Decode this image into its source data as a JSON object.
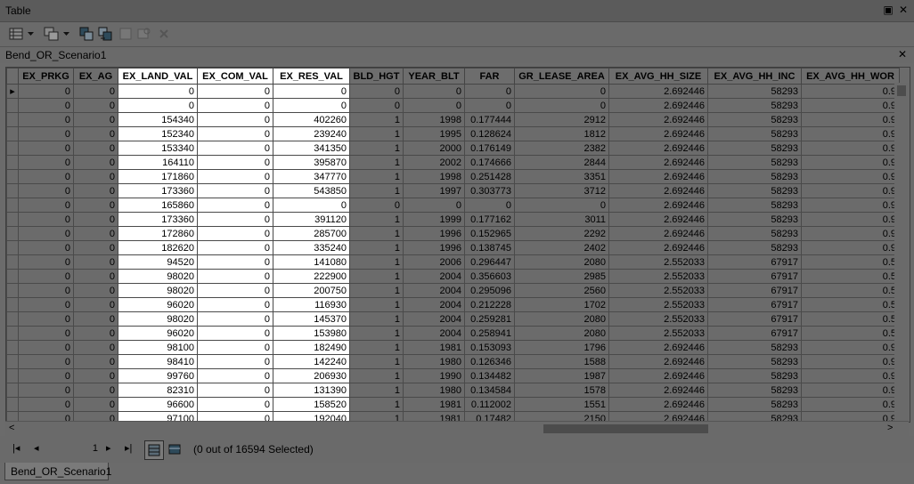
{
  "window": {
    "title": "Table",
    "restore_glyph": "▣",
    "close_glyph": "✕"
  },
  "toolbar": {
    "icons": [
      "table-options-icon",
      "dropdown-arrow-icon",
      "related-tables-icon",
      "dropdown-arrow-icon",
      "select-by-attributes-icon",
      "switch-selection-icon",
      "clear-selection-icon",
      "zoom-to-selected-icon",
      "delete-selected-icon"
    ]
  },
  "tab": {
    "name": "Bend_OR_Scenario1",
    "close_glyph": "✕"
  },
  "columns": [
    "EX_PRKG",
    "EX_AG",
    "EX_LAND_VAL",
    "EX_COM_VAL",
    "EX_RES_VAL",
    "BLD_HGT",
    "YEAR_BLT",
    "FAR",
    "GR_LEASE_AREA",
    "EX_AVG_HH_SIZE",
    "EX_AVG_HH_INC",
    "EX_AVG_HH_WOR"
  ],
  "selected_columns": [
    "EX_LAND_VAL",
    "EX_COM_VAL",
    "EX_RES_VAL"
  ],
  "rows": [
    {
      "marker": "▸",
      "cells": [
        "0",
        "0",
        "0",
        "0",
        "0",
        "0",
        "0",
        "0",
        "0",
        "2.692446",
        "58293",
        "0.9"
      ]
    },
    {
      "marker": "",
      "cells": [
        "0",
        "0",
        "0",
        "0",
        "0",
        "0",
        "0",
        "0",
        "0",
        "2.692446",
        "58293",
        "0.9"
      ]
    },
    {
      "marker": "",
      "cells": [
        "0",
        "0",
        "154340",
        "0",
        "402260",
        "1",
        "1998",
        "0.177444",
        "2912",
        "2.692446",
        "58293",
        "0.9"
      ]
    },
    {
      "marker": "",
      "cells": [
        "0",
        "0",
        "152340",
        "0",
        "239240",
        "1",
        "1995",
        "0.128624",
        "1812",
        "2.692446",
        "58293",
        "0.9"
      ]
    },
    {
      "marker": "",
      "cells": [
        "0",
        "0",
        "153340",
        "0",
        "341350",
        "1",
        "2000",
        "0.176149",
        "2382",
        "2.692446",
        "58293",
        "0.9"
      ]
    },
    {
      "marker": "",
      "cells": [
        "0",
        "0",
        "164110",
        "0",
        "395870",
        "1",
        "2002",
        "0.174666",
        "2844",
        "2.692446",
        "58293",
        "0.9"
      ]
    },
    {
      "marker": "",
      "cells": [
        "0",
        "0",
        "171860",
        "0",
        "347770",
        "1",
        "1998",
        "0.251428",
        "3351",
        "2.692446",
        "58293",
        "0.9"
      ]
    },
    {
      "marker": "",
      "cells": [
        "0",
        "0",
        "173360",
        "0",
        "543850",
        "1",
        "1997",
        "0.303773",
        "3712",
        "2.692446",
        "58293",
        "0.9"
      ]
    },
    {
      "marker": "",
      "cells": [
        "0",
        "0",
        "165860",
        "0",
        "0",
        "0",
        "0",
        "0",
        "0",
        "2.692446",
        "58293",
        "0.9"
      ]
    },
    {
      "marker": "",
      "cells": [
        "0",
        "0",
        "173360",
        "0",
        "391120",
        "1",
        "1999",
        "0.177162",
        "3011",
        "2.692446",
        "58293",
        "0.9"
      ]
    },
    {
      "marker": "",
      "cells": [
        "0",
        "0",
        "172860",
        "0",
        "285700",
        "1",
        "1996",
        "0.152965",
        "2292",
        "2.692446",
        "58293",
        "0.9"
      ]
    },
    {
      "marker": "",
      "cells": [
        "0",
        "0",
        "182620",
        "0",
        "335240",
        "1",
        "1996",
        "0.138745",
        "2402",
        "2.692446",
        "58293",
        "0.9"
      ]
    },
    {
      "marker": "",
      "cells": [
        "0",
        "0",
        "94520",
        "0",
        "141080",
        "1",
        "2006",
        "0.296447",
        "2080",
        "2.552033",
        "67917",
        "0.5"
      ]
    },
    {
      "marker": "",
      "cells": [
        "0",
        "0",
        "98020",
        "0",
        "222900",
        "1",
        "2004",
        "0.356603",
        "2985",
        "2.552033",
        "67917",
        "0.5"
      ]
    },
    {
      "marker": "",
      "cells": [
        "0",
        "0",
        "98020",
        "0",
        "200750",
        "1",
        "2004",
        "0.295096",
        "2560",
        "2.552033",
        "67917",
        "0.5"
      ]
    },
    {
      "marker": "",
      "cells": [
        "0",
        "0",
        "96020",
        "0",
        "116930",
        "1",
        "2004",
        "0.212228",
        "1702",
        "2.552033",
        "67917",
        "0.5"
      ]
    },
    {
      "marker": "",
      "cells": [
        "0",
        "0",
        "98020",
        "0",
        "145370",
        "1",
        "2004",
        "0.259281",
        "2080",
        "2.552033",
        "67917",
        "0.5"
      ]
    },
    {
      "marker": "",
      "cells": [
        "0",
        "0",
        "96020",
        "0",
        "153980",
        "1",
        "2004",
        "0.258941",
        "2080",
        "2.552033",
        "67917",
        "0.5"
      ]
    },
    {
      "marker": "",
      "cells": [
        "0",
        "0",
        "98100",
        "0",
        "182490",
        "1",
        "1981",
        "0.153093",
        "1796",
        "2.692446",
        "58293",
        "0.9"
      ]
    },
    {
      "marker": "",
      "cells": [
        "0",
        "0",
        "98410",
        "0",
        "142240",
        "1",
        "1980",
        "0.126346",
        "1588",
        "2.692446",
        "58293",
        "0.9"
      ]
    },
    {
      "marker": "",
      "cells": [
        "0",
        "0",
        "99760",
        "0",
        "206930",
        "1",
        "1990",
        "0.134482",
        "1987",
        "2.692446",
        "58293",
        "0.9"
      ]
    },
    {
      "marker": "",
      "cells": [
        "0",
        "0",
        "82310",
        "0",
        "131390",
        "1",
        "1980",
        "0.134584",
        "1578",
        "2.692446",
        "58293",
        "0.9"
      ]
    },
    {
      "marker": "",
      "cells": [
        "0",
        "0",
        "96600",
        "0",
        "158520",
        "1",
        "1981",
        "0.112002",
        "1551",
        "2.692446",
        "58293",
        "0.9"
      ]
    },
    {
      "marker": "",
      "cells": [
        "0",
        "0",
        "97100",
        "0",
        "192040",
        "1",
        "1981",
        "0.17482",
        "2150",
        "2.692446",
        "58293",
        "0.9"
      ]
    }
  ],
  "scroll": {
    "left_arrow": "<",
    "right_arrow": ">"
  },
  "navigation": {
    "first_glyph": "|◂",
    "prev_glyph": "◂",
    "page": "1",
    "next_glyph": "▸",
    "last_glyph": "▸|",
    "status": "(0 out of 16594 Selected)"
  },
  "bottom_tab": {
    "name": "Bend_OR_Scenario1"
  }
}
